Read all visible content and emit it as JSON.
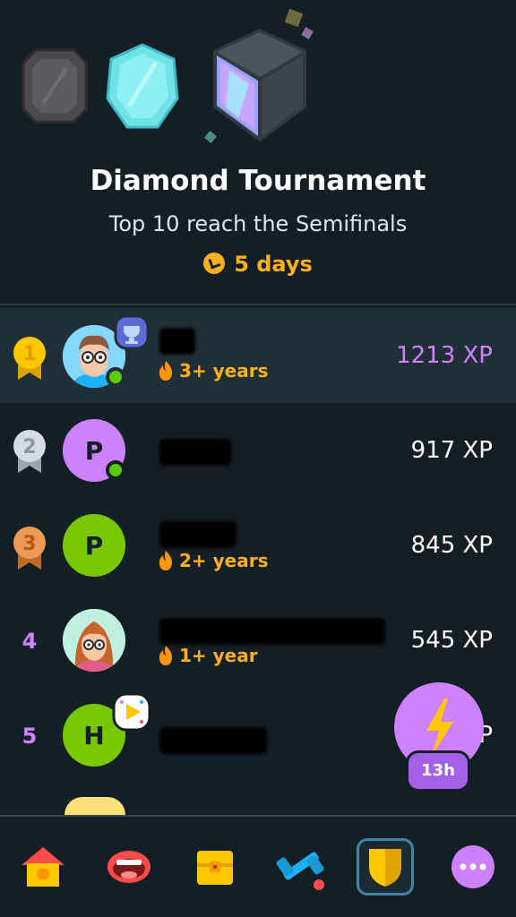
{
  "tournament": {
    "title": "Diamond Tournament",
    "subtitle": "Top 10 reach the Semifinals",
    "days_left": "5 days"
  },
  "leaderboard": [
    {
      "rank": "1",
      "xp": "1213 XP",
      "streak": "3+ years",
      "avatar_letter": "",
      "is_current_user": true
    },
    {
      "rank": "2",
      "xp": "917 XP",
      "streak": "",
      "avatar_letter": "P"
    },
    {
      "rank": "3",
      "xp": "845 XP",
      "streak": "2+ years",
      "avatar_letter": "P"
    },
    {
      "rank": "4",
      "xp": "545 XP",
      "streak": "1+ year",
      "avatar_letter": ""
    },
    {
      "rank": "5",
      "xp": "P",
      "streak": "",
      "avatar_letter": "H"
    }
  ],
  "boost": {
    "time_left": "13h"
  },
  "tabs": [
    {
      "icon": "home-icon"
    },
    {
      "icon": "speaking-mouth-icon"
    },
    {
      "icon": "treasure-chest-icon"
    },
    {
      "icon": "dumbbell-icon"
    },
    {
      "icon": "league-shield-icon",
      "active": true
    },
    {
      "icon": "more-icon"
    }
  ],
  "colors": {
    "background": "#131f24",
    "current_user_row": "#202f36",
    "accent_purple": "#ce82ff",
    "streak_orange": "#ffb020",
    "online_green": "#58cc02"
  }
}
